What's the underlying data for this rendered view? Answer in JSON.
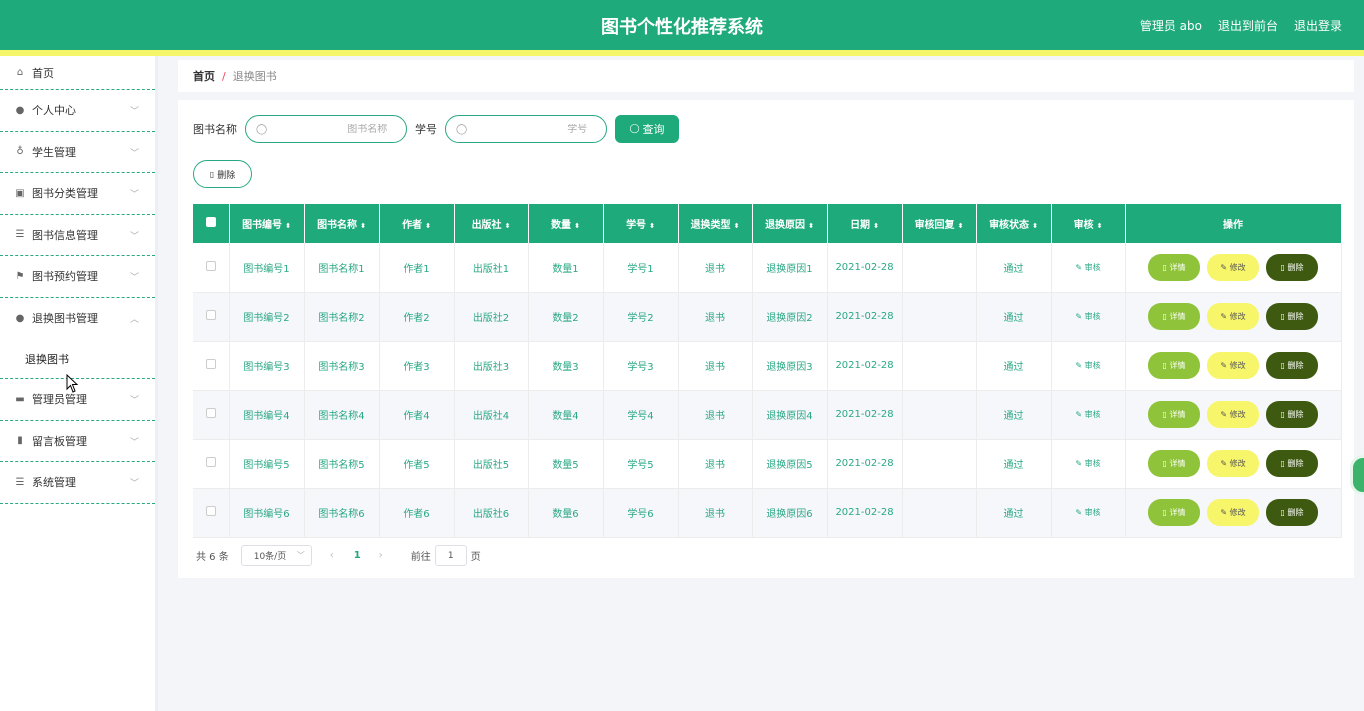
{
  "header": {
    "title": "图书个性化推荐系统",
    "user": "管理员 abo",
    "to_front": "退出到前台",
    "logout": "退出登录"
  },
  "sidebar": {
    "home": "首页",
    "items": [
      {
        "label": "个人中心",
        "icon": "person-icon"
      },
      {
        "label": "学生管理",
        "icon": "mic-icon"
      },
      {
        "label": "图书分类管理",
        "icon": "image-icon"
      },
      {
        "label": "图书信息管理",
        "icon": "list-icon"
      },
      {
        "label": "图书预约管理",
        "icon": "flag-icon"
      },
      {
        "label": "退换图书管理",
        "icon": "person-icon",
        "expanded": true
      }
    ],
    "sub_item": "退换图书",
    "items_after": [
      {
        "label": "管理员管理",
        "icon": "monitor-icon"
      },
      {
        "label": "留言板管理",
        "icon": "bar-chart-icon"
      },
      {
        "label": "系统管理",
        "icon": "list-icon"
      }
    ]
  },
  "breadcrumb": {
    "home": "首页",
    "sep": "/",
    "current": "退换图书"
  },
  "search": {
    "book_name_label": "图书名称",
    "book_name_placeholder": "图书名称",
    "student_no_label": "学号",
    "student_no_placeholder": "学号",
    "query_label": "查询",
    "delete_label": "删除"
  },
  "table": {
    "headers": [
      "图书编号",
      "图书名称",
      "作者",
      "出版社",
      "数量",
      "学号",
      "退换类型",
      "退换原因",
      "日期",
      "审核回复",
      "审核状态",
      "审核",
      "操作"
    ],
    "rows": [
      [
        "图书编号1",
        "图书名称1",
        "作者1",
        "出版社1",
        "数量1",
        "学号1",
        "退书",
        "退换原因1",
        "2021-02-28",
        "",
        "通过",
        "审核"
      ],
      [
        "图书编号2",
        "图书名称2",
        "作者2",
        "出版社2",
        "数量2",
        "学号2",
        "退书",
        "退换原因2",
        "2021-02-28",
        "",
        "通过",
        "审核"
      ],
      [
        "图书编号3",
        "图书名称3",
        "作者3",
        "出版社3",
        "数量3",
        "学号3",
        "退书",
        "退换原因3",
        "2021-02-28",
        "",
        "通过",
        "审核"
      ],
      [
        "图书编号4",
        "图书名称4",
        "作者4",
        "出版社4",
        "数量4",
        "学号4",
        "退书",
        "退换原因4",
        "2021-02-28",
        "",
        "通过",
        "审核"
      ],
      [
        "图书编号5",
        "图书名称5",
        "作者5",
        "出版社5",
        "数量5",
        "学号5",
        "退书",
        "退换原因5",
        "2021-02-28",
        "",
        "通过",
        "审核"
      ],
      [
        "图书编号6",
        "图书名称6",
        "作者6",
        "出版社6",
        "数量6",
        "学号6",
        "退书",
        "退换原因6",
        "2021-02-28",
        "",
        "通过",
        "审核"
      ]
    ],
    "op_detail": "详情",
    "op_edit": "修改",
    "op_delete": "删除"
  },
  "pager": {
    "total": "共 6 条",
    "page_size": "10条/页",
    "current_page": "1",
    "goto_label": "前往",
    "goto_value": "1",
    "page_suffix": "页"
  },
  "colors": {
    "primary": "#1faa7b",
    "stripe": "#f6f66a",
    "detail": "#8fc43a",
    "edit": "#f7f56a",
    "delete": "#3d5a10"
  }
}
